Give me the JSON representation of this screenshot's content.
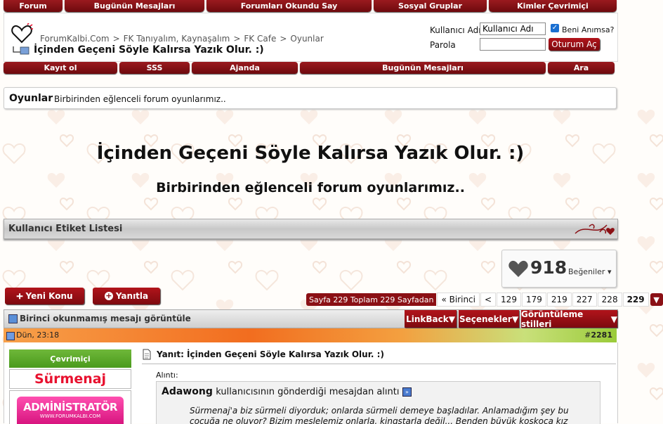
{
  "colors": {
    "brand": "#8b1015",
    "accent": "#b1141b",
    "highlight": "#e8102e",
    "bg": "#fffdfa"
  },
  "topnav": [
    "Forum",
    "Bugünün Mesajları",
    "Forumları Okundu Say",
    "Sosyal Gruplar",
    "Kimler Çevrimiçi"
  ],
  "header": {
    "breadcrumb": [
      "ForumKalbi.Com",
      "FK Tanıyalım, Kaynaşalım",
      "FK Cafe",
      "Oyunlar"
    ],
    "breadcrumb_sep": ">",
    "thread_title": "İçinden Geçeni Söyle Kalırsa Yazık Olur. :)"
  },
  "login": {
    "username_label": "Kullanıcı Adı",
    "username_value": "Kullanıcı Adı",
    "remember_label": "Beni Anımsa?",
    "password_label": "Parola",
    "submit_label": "Oturum Aç"
  },
  "subnav": [
    "Kayıt ol",
    "SSS",
    "Ajanda",
    "Bugünün Mesajları",
    "Ara"
  ],
  "forum_desc": {
    "name": "Oyunlar",
    "text": "Birbirinden eğlenceli forum oyunlarımız.."
  },
  "banner": {
    "title": "İçinden Geçeni Söyle Kalırsa Yazık Olur. :)",
    "subtitle": "Birbirinden eğlenceli forum oyunlarımız.."
  },
  "tag_list_label": "Kullanıcı Etiket Listesi",
  "likes": {
    "count": "918",
    "label": "Beğeniler"
  },
  "buttons": {
    "new_thread": "Yeni Konu",
    "reply": "Yanıtla"
  },
  "pagination": {
    "summary": "Sayfa 229 Toplam 229 Sayfadan",
    "first": "« Birinci",
    "prev": "<",
    "pages": [
      "129",
      "179",
      "219",
      "227",
      "228",
      "229"
    ],
    "current": "229"
  },
  "thread_tools": {
    "first_unread": "Birinci okunmamış mesajı görüntüle",
    "linkback": "LinkBack",
    "options": "Seçenekler",
    "display": "Görüntüleme stilleri"
  },
  "post": {
    "date": "Dün, 23:18",
    "number_prefix": "#",
    "number": "2281",
    "status": "Çevrimiçi",
    "username": "Sürmenaj",
    "rank_image_text": "ADMİNİSTRATÖR",
    "rank_image_sub": "WWW.FORUMKALBI.COM",
    "title": "Yanıt: İçinden Geçeni Söyle Kalırsa Yazık Olur. :)",
    "quote_label": "Alıntı:",
    "quote_author": "Adawong",
    "quote_from": "kullanıcısının gönderdiği mesajdan alıntı",
    "quote_text": "Sürmenaj'a biz sürmeli diyorduk; onlarda sürmeli demeye başladılar. Anlamadığım şey bu çocuğa ne oluyor? Bizim meslelemiz onlarla, kingstarla değil... Benden büyük koskoca kız"
  }
}
